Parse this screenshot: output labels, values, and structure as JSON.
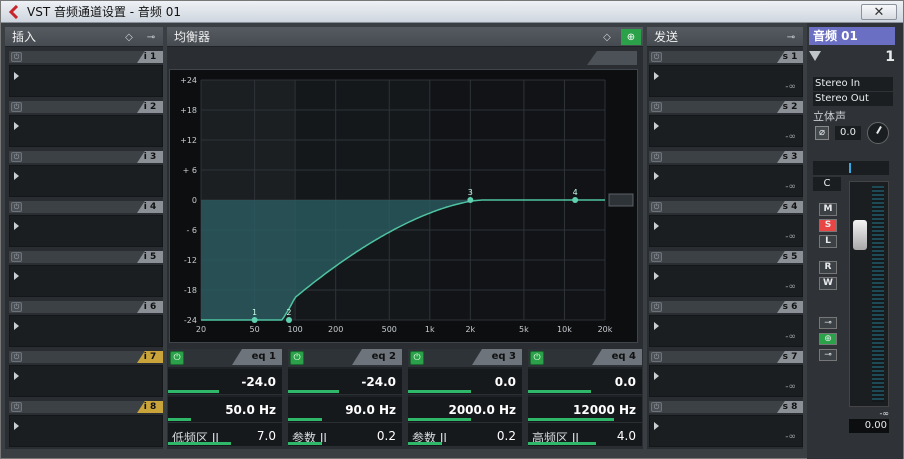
{
  "window": {
    "title": "VST 音频通道设置 - 音频 01"
  },
  "inserts": {
    "label": "插入",
    "slots": [
      "i 1",
      "i 2",
      "i 3",
      "i 4",
      "i 5",
      "i 6",
      "i 7",
      "i 8"
    ]
  },
  "equalizer": {
    "label": "均衡器",
    "y_ticks": [
      "+24",
      "+18",
      "+12",
      "+ 6",
      "0",
      "- 6",
      "-12",
      "-18",
      "-24"
    ],
    "x_ticks": [
      "20",
      "50",
      "100",
      "200",
      "500",
      "1k",
      "2k",
      "5k",
      "10k",
      "20k"
    ],
    "points": [
      "1",
      "2",
      "3",
      "4"
    ],
    "bands": [
      {
        "name": "eq 1",
        "gain": "-24.0",
        "freq": "50.0 Hz",
        "mode": "低频区 II",
        "q": "7.0",
        "gain_fill": 0.45,
        "freq_fill": 0.2,
        "q_fill": 0.55
      },
      {
        "name": "eq 2",
        "gain": "-24.0",
        "freq": "90.0 Hz",
        "mode": "参数 II",
        "q": "0.2",
        "gain_fill": 0.45,
        "freq_fill": 0.3,
        "q_fill": 0.3
      },
      {
        "name": "eq 3",
        "gain": "0.0",
        "freq": "2000.0 Hz",
        "mode": "参数 II",
        "q": "0.2",
        "gain_fill": 0.55,
        "freq_fill": 0.55,
        "q_fill": 0.3
      },
      {
        "name": "eq 4",
        "gain": "0.0",
        "freq": "12000 Hz",
        "mode": "高频区 II",
        "q": "4.0",
        "gain_fill": 0.55,
        "freq_fill": 0.75,
        "q_fill": 0.6
      }
    ]
  },
  "sends": {
    "label": "发送",
    "slots": [
      "s 1",
      "s 2",
      "s 3",
      "s 4",
      "s 5",
      "s 6",
      "s 7",
      "s 8"
    ],
    "level": "-∞"
  },
  "channel": {
    "name": "音频 01",
    "number": "1",
    "input": "Stereo In",
    "output": "Stereo Out",
    "type": "立体声",
    "phase_value": "0.0",
    "pan": "C",
    "btn_m": "M",
    "btn_s": "S",
    "btn_l": "L",
    "btn_r": "R",
    "btn_w": "W",
    "level": "0.00",
    "peak": "-∞"
  },
  "colors": {
    "accent": "#2fb86a",
    "curve": "#4fc3a1",
    "fill": "#2b6066"
  }
}
